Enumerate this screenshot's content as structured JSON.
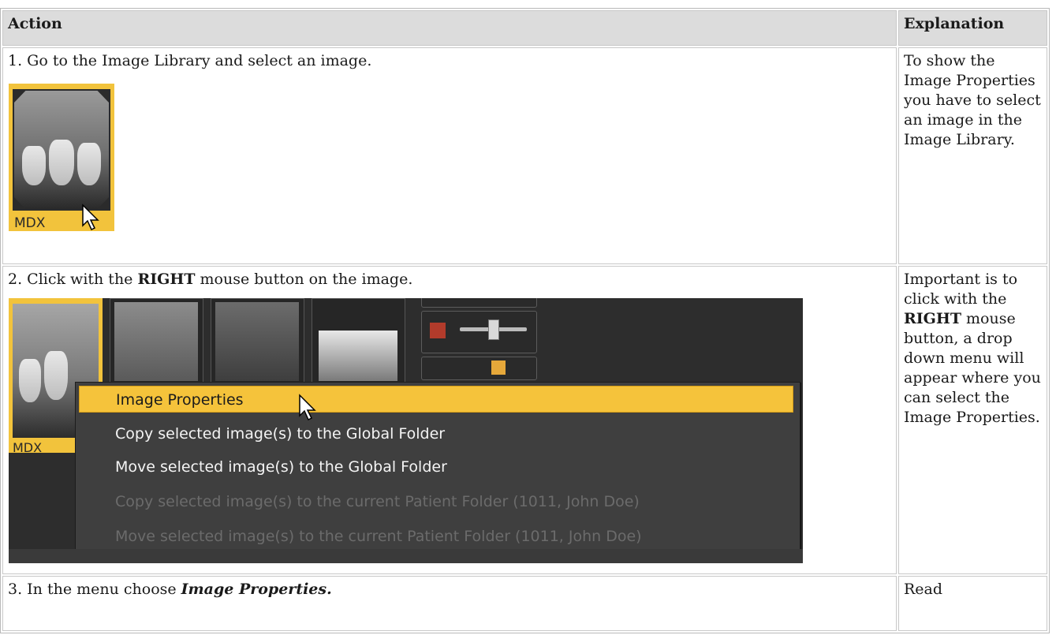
{
  "table": {
    "headers": {
      "action": "Action",
      "explanation": "Explanation"
    },
    "rows": [
      {
        "action_text": "1. Go to the Image Library and select an image.",
        "thumbnail_label": "MDX",
        "explanation": "To show the Image Properties you have to select an image in the Image Library."
      },
      {
        "action_prefix": "2. Click with the ",
        "action_bold": "RIGHT",
        "action_suffix": " mouse button on the image.",
        "thumbnail_label": "MDX",
        "context_menu": [
          {
            "label": "Image Properties",
            "state": "highlighted"
          },
          {
            "label": "Copy selected image(s) to the Global Folder",
            "state": "enabled"
          },
          {
            "label": "Move selected image(s) to the Global Folder",
            "state": "enabled"
          },
          {
            "label": "Copy selected image(s) to the current Patient Folder (1011, John Doe)",
            "state": "disabled"
          },
          {
            "label": "Move selected image(s) to the current Patient Folder (1011, John Doe)",
            "state": "disabled"
          }
        ],
        "explanation_prefix": "Important is to click with the ",
        "explanation_bold": "RIGHT",
        "explanation_suffix": " mouse button, a drop down menu will appear where you can select the Image Properties."
      },
      {
        "action_prefix": "3. In the menu choose ",
        "action_bold_italic": "Image Properties.",
        "explanation": "Read"
      }
    ]
  },
  "colors": {
    "highlight": "#f5c33b",
    "panel": "#2d2d2d",
    "header_bg": "#dcdcdc"
  }
}
